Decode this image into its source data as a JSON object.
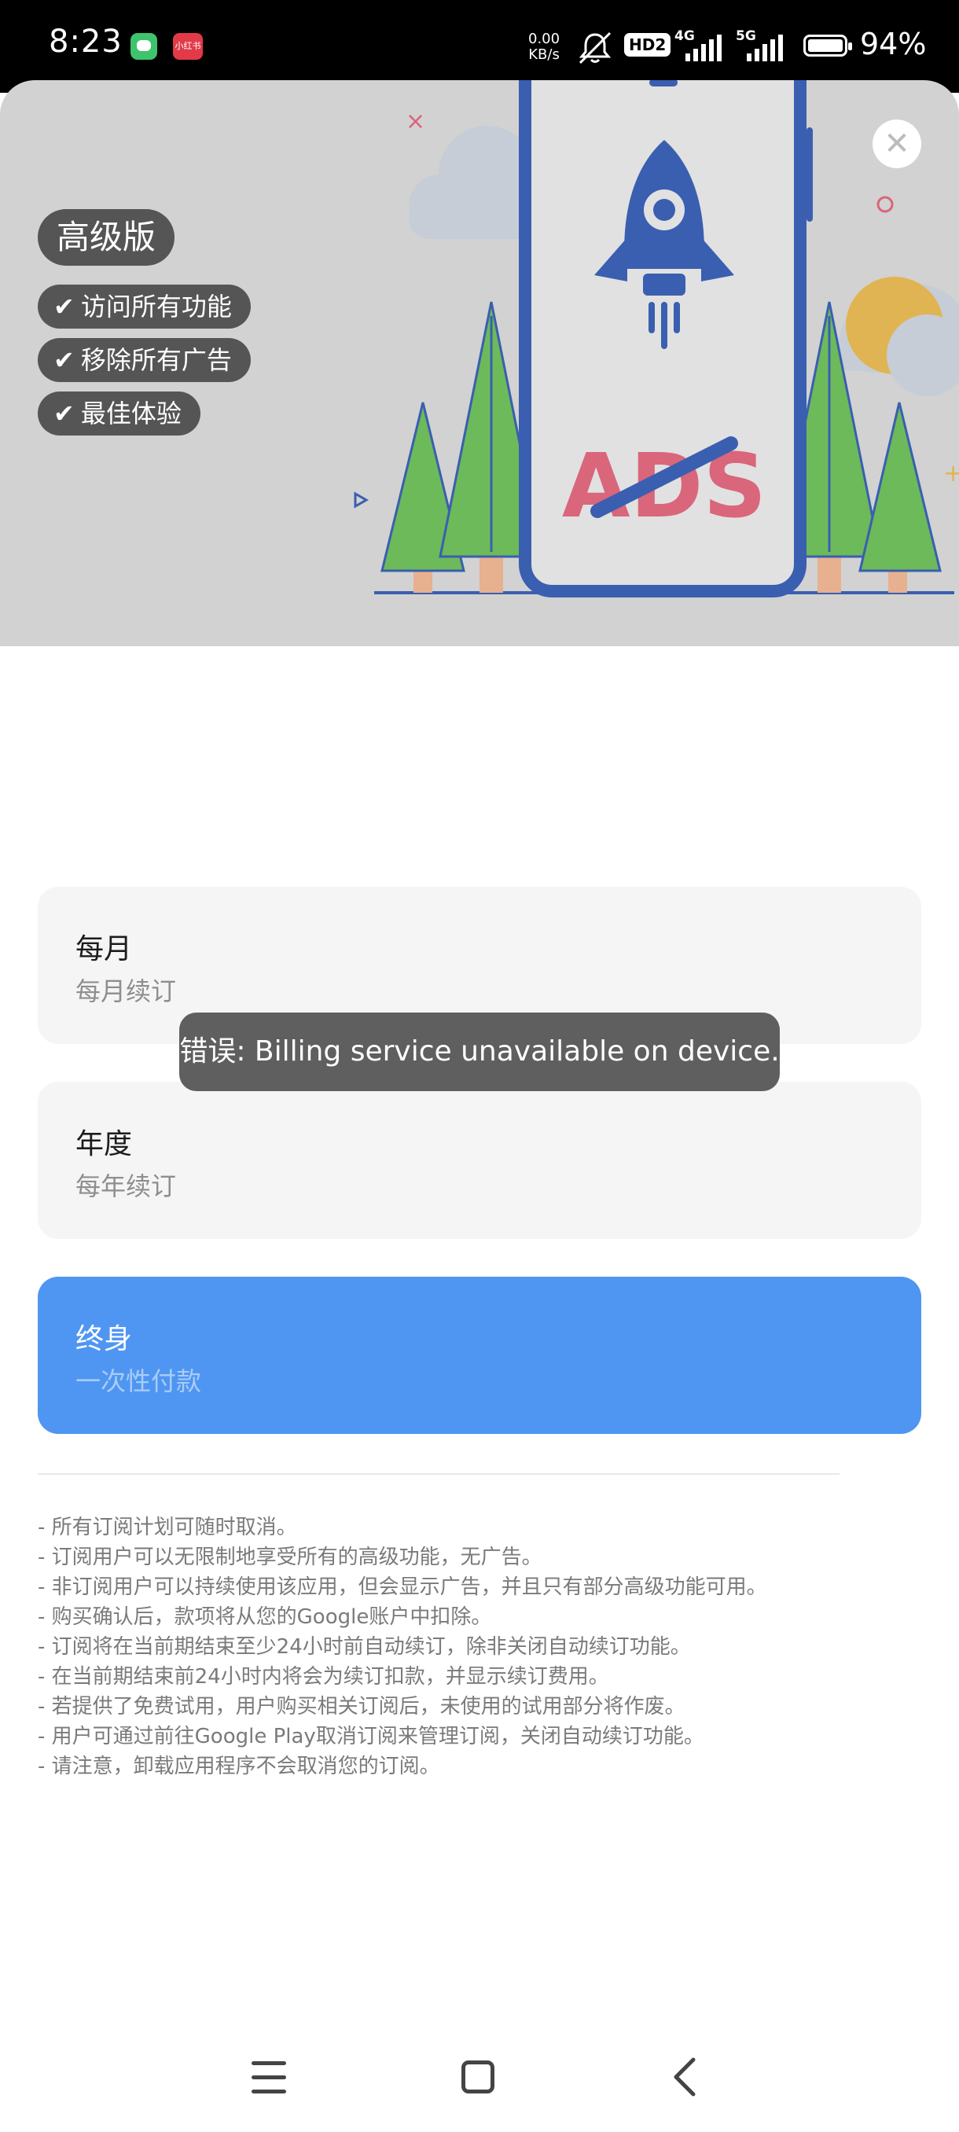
{
  "status_bar": {
    "time": "8:23",
    "app_badge_text": "小红书",
    "net_speed_value": "0.00",
    "net_speed_unit": "KB/s",
    "hd_label": "HD2",
    "signal1_label": "4G",
    "signal2_label": "5G",
    "battery_percent": "94%",
    "battery_level": 0.94
  },
  "hero": {
    "title_tag": "高级版",
    "features": [
      "访问所有功能",
      "移除所有广告",
      "最佳体验"
    ],
    "check_glyph": "✔",
    "illustration_text": "ADS",
    "close_icon": "close-icon"
  },
  "plans": [
    {
      "name": "每月",
      "desc": "每月续订",
      "selected": false
    },
    {
      "name": "年度",
      "desc": "每年续订",
      "selected": false
    },
    {
      "name": "终身",
      "desc": "一次性付款",
      "selected": true
    }
  ],
  "toast": {
    "message": "错误: Billing service unavailable on device."
  },
  "notes": [
    "- 所有订阅计划可随时取消。",
    "- 订阅用户可以无限制地享受所有的高级功能，无广告。",
    "- 非订阅用户可以持续使用该应用，但会显示广告，并且只有部分高级功能可用。",
    "- 购买确认后，款项将从您的Google账户中扣除。",
    "- 订阅将在当前期结束至少24小时前自动续订，除非关闭自动续订功能。",
    "- 在当前期结束前24小时内将会为续订扣款，并显示续订费用。",
    "- 若提供了免费试用，用户购买相关订阅后，未使用的试用部分将作废。",
    "- 用户可通过前往Google Play取消订阅来管理订阅，关闭自动续订功能。",
    "- 请注意，卸载应用程序不会取消您的订阅。"
  ],
  "colors": {
    "selected_plan": "#4f96f2",
    "tag_bg": "#555555",
    "phone_frame": "#3a5fb0",
    "ads_text": "#d9667a"
  }
}
